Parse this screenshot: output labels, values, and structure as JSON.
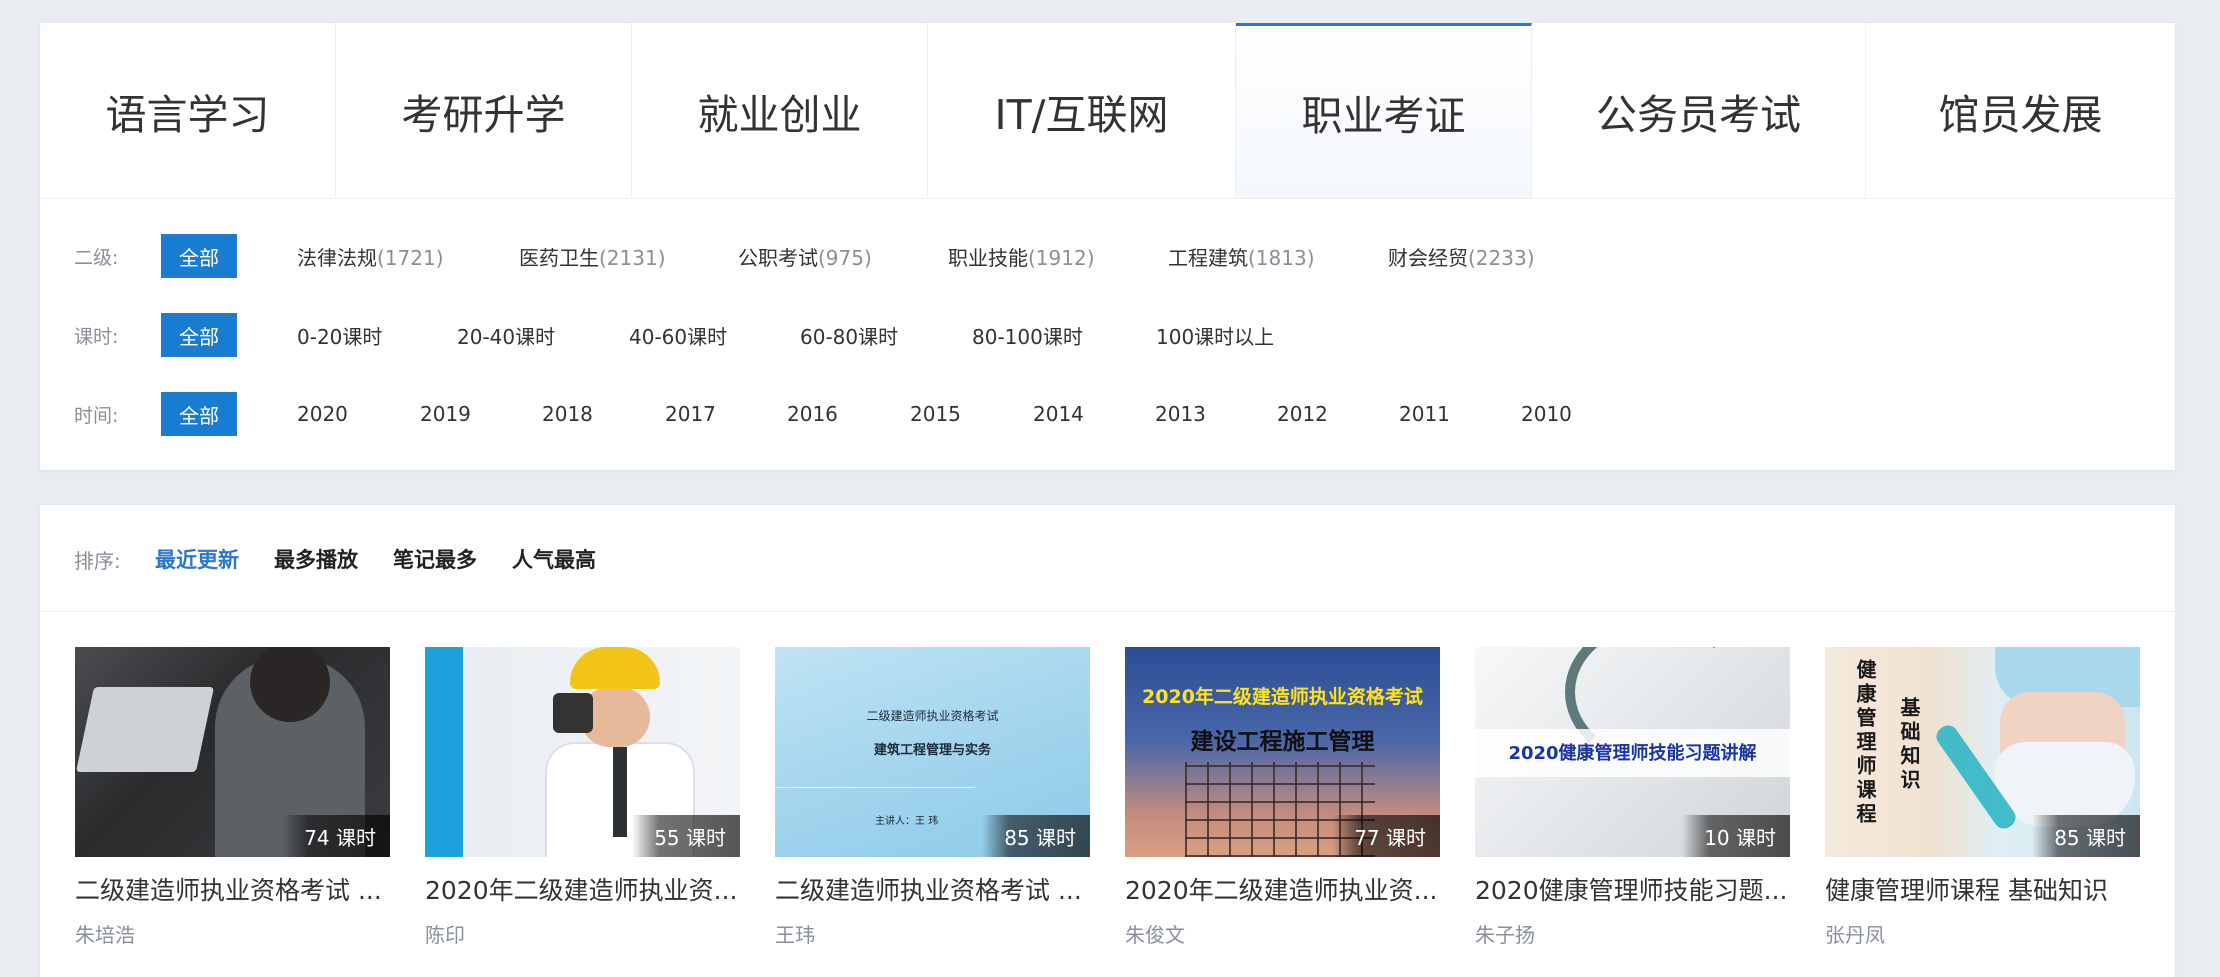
{
  "tabs": [
    {
      "label": "语言学习"
    },
    {
      "label": "考研升学"
    },
    {
      "label": "就业创业"
    },
    {
      "label": "IT/互联网"
    },
    {
      "label": "职业考证"
    },
    {
      "label": "公务员考试"
    },
    {
      "label": "馆员发展"
    }
  ],
  "active_tab": "职业考证",
  "filters": {
    "level2": {
      "label": "二级:",
      "all": "全部",
      "options": [
        {
          "name": "法律法规",
          "count": "(1721)"
        },
        {
          "name": "医药卫生",
          "count": "(2131)"
        },
        {
          "name": "公职考试",
          "count": "(975)"
        },
        {
          "name": "职业技能",
          "count": "(1912)"
        },
        {
          "name": "工程建筑",
          "count": "(1813)"
        },
        {
          "name": "财会经贸",
          "count": "(2233)"
        }
      ]
    },
    "hours": {
      "label": "课时:",
      "all": "全部",
      "options": [
        "0-20课时",
        "20-40课时",
        "40-60课时",
        "60-80课时",
        "80-100课时",
        "100课时以上"
      ]
    },
    "time": {
      "label": "时间:",
      "all": "全部",
      "options": [
        "2020",
        "2019",
        "2018",
        "2017",
        "2016",
        "2015",
        "2014",
        "2013",
        "2012",
        "2011",
        "2010"
      ]
    }
  },
  "sort": {
    "label": "排序:",
    "items": [
      "最近更新",
      "最多播放",
      "笔记最多",
      "人气最高"
    ],
    "active": "最近更新"
  },
  "courses": [
    {
      "hours": "74 课时",
      "title": "二级建造师执业资格考试 ...",
      "author": "朱培浩"
    },
    {
      "hours": "55 课时",
      "title": "2020年二级建造师执业资...",
      "author": "陈印"
    },
    {
      "hours": "85 课时",
      "title": "二级建造师执业资格考试 ...",
      "author": "王玮",
      "thumb_text": {
        "line1": "二级建造师执业资格考试",
        "line2": "建筑工程管理与实务",
        "line3": "主讲人：王 玮"
      }
    },
    {
      "hours": "77 课时",
      "title": "2020年二级建造师执业资...",
      "author": "朱俊文",
      "thumb_text": {
        "line1": "2020年二级建造师执业资格考试",
        "line2": "建设工程施工管理"
      }
    },
    {
      "hours": "10 课时",
      "title": "2020健康管理师技能习题...",
      "author": "朱子扬",
      "thumb_text": {
        "line1": "2020健康管理师技能习题讲解"
      }
    },
    {
      "hours": "85 课时",
      "title": "健康管理师课程 基础知识",
      "author": "张丹凤",
      "thumb_text": {
        "line1": "健康管理师课程",
        "line2": "基础知识"
      }
    }
  ],
  "colors": {
    "accent": "#1a7cd1",
    "sort_active": "#2b77d0"
  }
}
